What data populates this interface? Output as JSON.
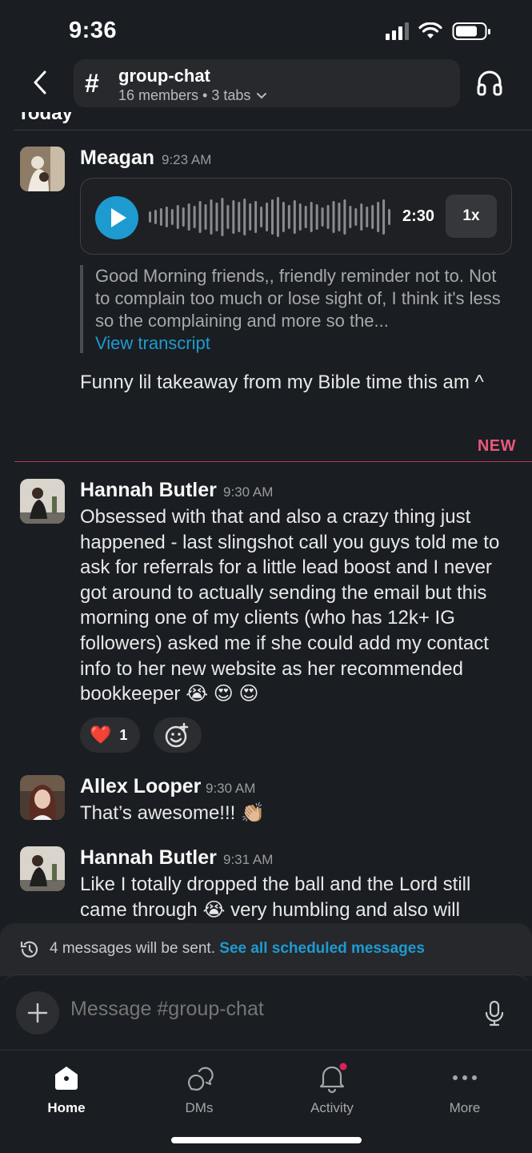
{
  "status": {
    "time": "9:36"
  },
  "header": {
    "channel_name": "group-chat",
    "channel_meta": "16 members • 3 tabs",
    "day_label": "Today"
  },
  "messages": [
    {
      "author": "Meagan",
      "time": "9:23 AM",
      "audio": {
        "duration": "2:30",
        "speed": "1x"
      },
      "transcript": "Good Morning friends,, friendly reminder not to. Not to complain too much or lose sight of, I think it's less so the complaining and more so the...",
      "transcript_link": "View transcript",
      "text": "Funny lil takeaway from my Bible time this am ^"
    },
    {
      "author": "Hannah Butler",
      "time": "9:30 AM",
      "text": "Obsessed with that and also a crazy thing just happened - last slingshot call you guys told me to ask for referrals for a little lead boost and I never got around to actually sending the email but this morning one of my clients (who has 12k+ IG followers) asked me if she could add my contact info to her new website as her recommended bookkeeper 😭 😍 😍",
      "reaction": {
        "emoji": "❤️",
        "count": "1"
      }
    },
    {
      "author": "Allex Looper",
      "time": "9:30 AM",
      "text": "That’s awesome!!! 👏🏼"
    },
    {
      "author": "Hannah Butler",
      "time": "9:31 AM",
      "text": "Like I totally dropped the ball and the Lord still came through 😭  very humbling and also will"
    }
  ],
  "new_divider": "NEW",
  "scheduled": {
    "text": "4 messages will be sent.",
    "link": "See all scheduled messages"
  },
  "composer": {
    "placeholder": "Message #group-chat"
  },
  "tabs": [
    {
      "label": "Home",
      "icon": "home-icon",
      "active": true
    },
    {
      "label": "DMs",
      "icon": "dms-icon"
    },
    {
      "label": "Activity",
      "icon": "bell-icon",
      "badge": true
    },
    {
      "label": "More",
      "icon": "more-icon"
    }
  ],
  "colors": {
    "accent": "#1d9bd1",
    "new": "#e8587c",
    "background": "#1a1d21"
  }
}
